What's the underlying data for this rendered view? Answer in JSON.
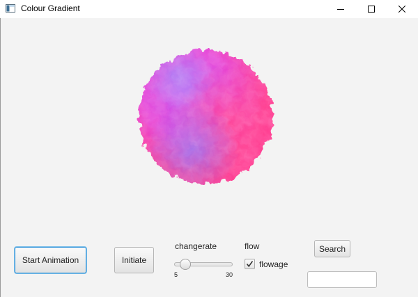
{
  "window": {
    "title": "Colour Gradient",
    "icons": {
      "app": "app-window-icon",
      "minimize": "minimize-icon",
      "maximize": "maximize-icon",
      "close": "close-icon"
    }
  },
  "canvas": {
    "content": "colour-gradient-blob",
    "colors": [
      "#ff3fa0",
      "#e033d8",
      "#9a6ff0",
      "#ff2f7a",
      "#c548e8"
    ]
  },
  "controls": {
    "start_label": "Start Animation",
    "initiate_label": "Initiate",
    "changerate_label": "changerate",
    "slider": {
      "min": "5",
      "max": "30",
      "value": 8
    },
    "flow_label": "flow",
    "flowage_label": "flowage",
    "flowage_checked": true,
    "search_label": "Search",
    "search_value": ""
  },
  "colors": {
    "focus_border": "#2b90d9",
    "background": "#f3f3f3"
  }
}
